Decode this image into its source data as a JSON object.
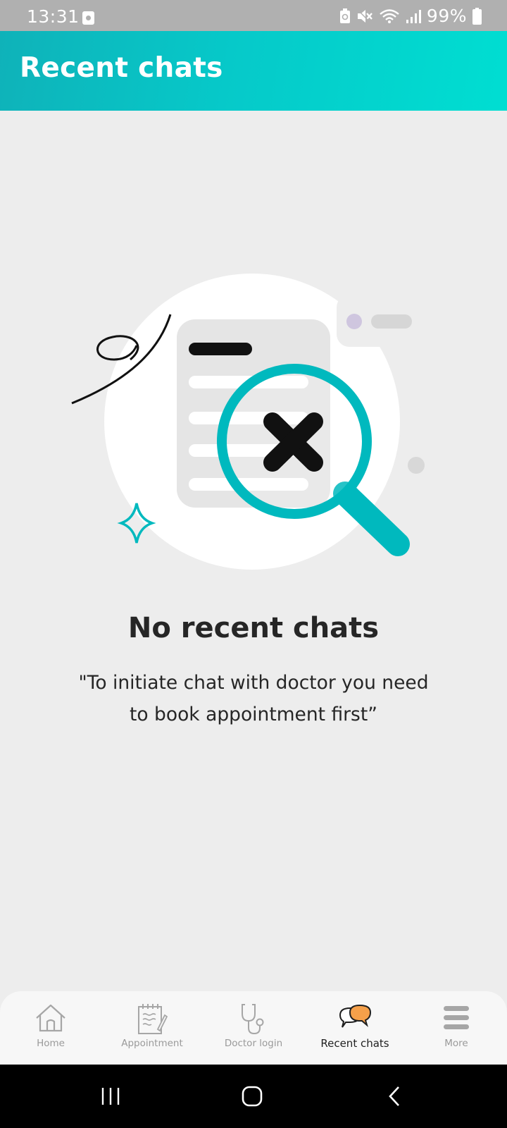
{
  "status_bar": {
    "time": "13:31",
    "battery": "99%"
  },
  "header": {
    "title": "Recent chats"
  },
  "empty_state": {
    "title": "No recent chats",
    "message": "\"To initiate chat with doctor you need to book appointment first”"
  },
  "bottom_nav": {
    "items": [
      {
        "label": "Home",
        "icon": "home-icon"
      },
      {
        "label": "Appointment",
        "icon": "appointment-icon"
      },
      {
        "label": "Doctor login",
        "icon": "stethoscope-icon"
      },
      {
        "label": "Recent chats",
        "icon": "chat-bubbles-icon",
        "active": true
      },
      {
        "label": "More",
        "icon": "menu-icon"
      }
    ]
  },
  "colors": {
    "accent": "#00b9be",
    "header_start": "#0fb2b9",
    "header_end": "#00ded2",
    "chat_icon_orange": "#f5a04a"
  }
}
